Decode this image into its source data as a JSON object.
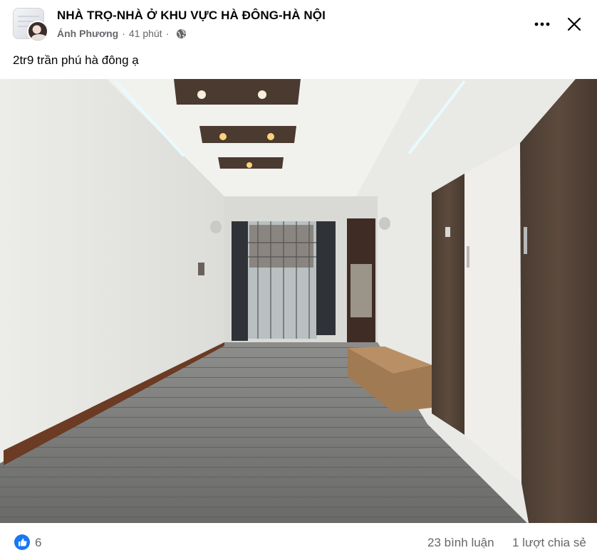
{
  "post": {
    "group_name": "NHÀ TRỌ-NHÀ Ở KHU VỰC HÀ ĐÔNG-HÀ NỘI",
    "author": "Ánh Phương",
    "separator": "·",
    "time": "41 phút",
    "privacy_icon": "globe-icon",
    "text": "2tr9 trần phú hà đông ạ"
  },
  "header_actions": {
    "more_icon": "more-dots-icon",
    "close_icon": "close-icon"
  },
  "stats": {
    "reaction_icon": "like-icon",
    "reaction_count": "6",
    "comments": "23 bình luận",
    "shares": "1 lượt chia sẻ"
  },
  "colors": {
    "text_primary": "#050505",
    "text_secondary": "#65676b",
    "like_blue": "#1877f2"
  }
}
